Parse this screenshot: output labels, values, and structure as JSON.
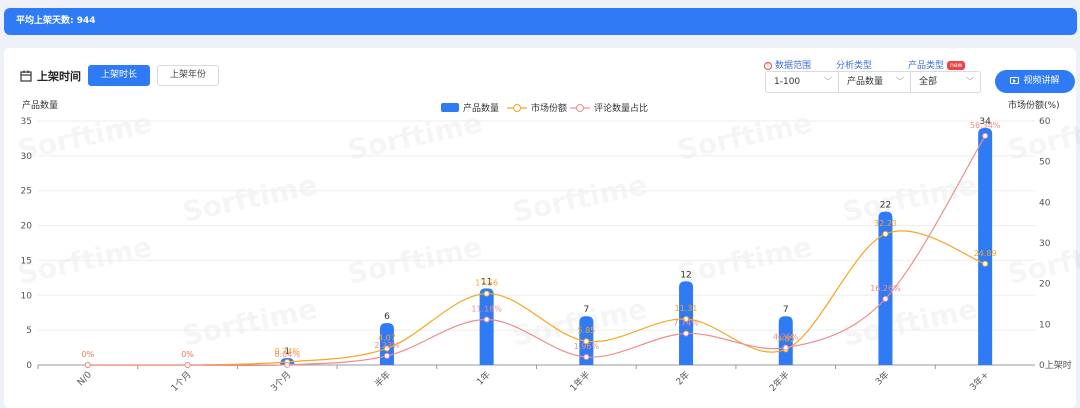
{
  "banner": {
    "text": "平均上架天数: 944"
  },
  "header": {
    "title": "上架时间",
    "tabs": [
      {
        "label": "上架时长",
        "active": true
      },
      {
        "label": "上架年份",
        "active": false
      }
    ],
    "video_button": "视频讲解"
  },
  "filters": {
    "data_range": {
      "label": "数据范围",
      "value": "1-100"
    },
    "analysis_type": {
      "label": "分析类型",
      "value": "产品数量"
    },
    "product_type": {
      "label": "产品类型",
      "badge": "new",
      "value": "全部"
    }
  },
  "watermark": "Sorftime",
  "colors": {
    "bar": "#2f7af5",
    "market_share": "#f5a623",
    "review_ratio": "#f08c8c",
    "accent": "#2f7af5"
  },
  "chart_data": {
    "type": "bar",
    "categories": [
      "N/0",
      "1个月",
      "3个月",
      "半年",
      "1年",
      "1年半",
      "2年",
      "2年半",
      "3年",
      "3年+"
    ],
    "ylabel": "产品数量",
    "y2label": "市场份额(%)",
    "ylim": [
      0,
      35
    ],
    "yticks": [
      "0",
      "5",
      "10",
      "15",
      "20",
      "25",
      "30",
      "35"
    ],
    "y2lim": [
      0,
      60
    ],
    "y2ticks": [
      "0上架时",
      "10",
      "20",
      "30",
      "40",
      "50",
      "60"
    ],
    "legend": [
      "产品数量",
      "市场份额",
      "评论数量占比"
    ],
    "legend_position": "top-center",
    "series": [
      {
        "name": "产品数量",
        "type": "bar",
        "axis": "left",
        "values": [
          0,
          0,
          1,
          6,
          11,
          7,
          12,
          7,
          22,
          34
        ]
      },
      {
        "name": "市场份额",
        "type": "line",
        "axis": "right",
        "values": [
          0,
          0,
          0.74,
          4.07,
          17.56,
          5.85,
          11.31,
          3.85,
          32.23,
          24.89
        ],
        "labels": [
          "0%",
          "0%",
          "0.74%",
          "4.07",
          "17.56",
          "5.85",
          "11.31",
          "3.85",
          "32.23",
          "24.89"
        ]
      },
      {
        "name": "评论数量占比",
        "type": "line",
        "axis": "right",
        "values": [
          0,
          0,
          0.04,
          2.23,
          11.18,
          1.96,
          7.74,
          4.26,
          16.26,
          56.34
        ],
        "labels": [
          "0%",
          "0%",
          "0.04%",
          "2.23%",
          "11.18%",
          "1.96%",
          "7.74%",
          "4.26%",
          "16.26%",
          "56.34%"
        ]
      }
    ],
    "grid": true
  }
}
